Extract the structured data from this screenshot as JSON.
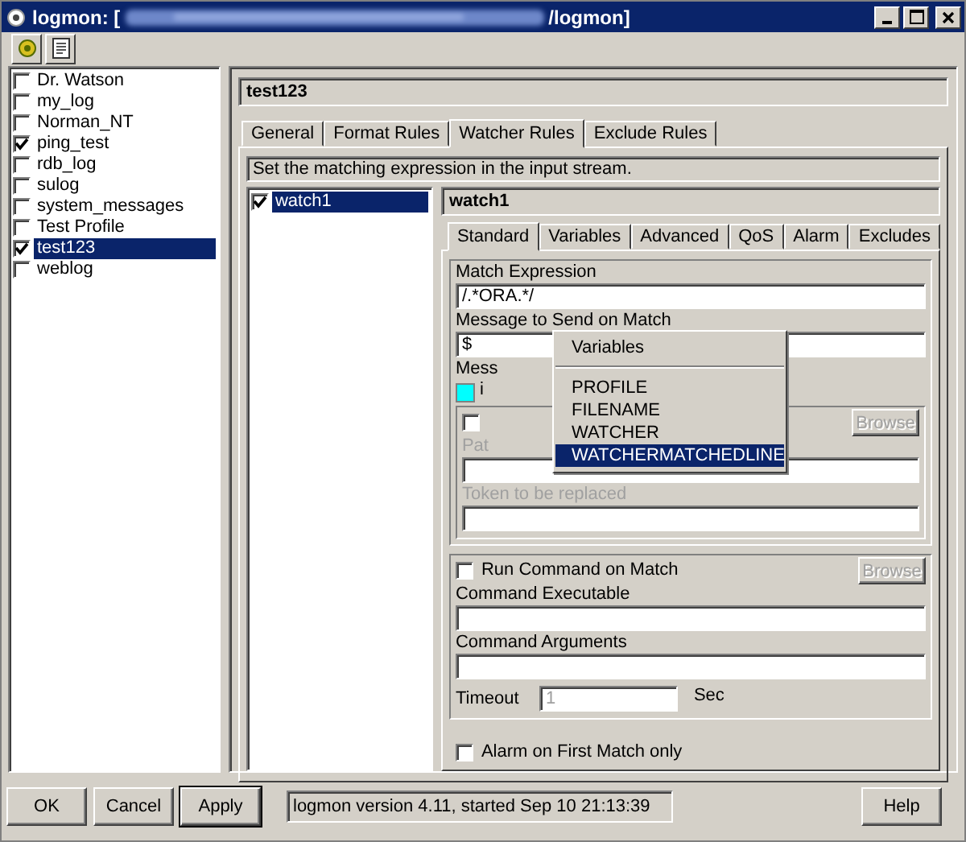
{
  "window": {
    "title_start": "logmon: [",
    "title_end": "/logmon]"
  },
  "profiles": [
    {
      "label": "Dr. Watson",
      "checked": false,
      "selected": false
    },
    {
      "label": "my_log",
      "checked": false,
      "selected": false
    },
    {
      "label": "Norman_NT",
      "checked": false,
      "selected": false
    },
    {
      "label": "ping_test",
      "checked": true,
      "selected": false
    },
    {
      "label": "rdb_log",
      "checked": false,
      "selected": false
    },
    {
      "label": "sulog",
      "checked": false,
      "selected": false
    },
    {
      "label": "system_messages",
      "checked": false,
      "selected": false
    },
    {
      "label": "Test Profile",
      "checked": false,
      "selected": false
    },
    {
      "label": "test123",
      "checked": true,
      "selected": true
    },
    {
      "label": "weblog",
      "checked": false,
      "selected": false
    }
  ],
  "profile_header": "test123",
  "tabs": [
    {
      "label": "General",
      "selected": false
    },
    {
      "label": "Format Rules",
      "selected": false
    },
    {
      "label": "Watcher Rules",
      "selected": true
    },
    {
      "label": "Exclude Rules",
      "selected": false
    }
  ],
  "hint": "Set the matching expression in the input stream.",
  "watchers": [
    {
      "label": "watch1",
      "checked": true,
      "selected": true
    }
  ],
  "watcher_header": "watch1",
  "subtabs": [
    {
      "label": "Standard",
      "selected": true
    },
    {
      "label": "Variables",
      "selected": false
    },
    {
      "label": "Advanced",
      "selected": false
    },
    {
      "label": "QoS",
      "selected": false
    },
    {
      "label": "Alarm",
      "selected": false
    },
    {
      "label": "Excludes",
      "selected": false
    }
  ],
  "standard": {
    "match_label": "Match Expression",
    "match_value": "/.*ORA.*/",
    "message_label": "Message to Send on Match",
    "message_value": "$",
    "type_label": "Mess",
    "type_text": "i",
    "path_checked": false,
    "path_label": "Pat",
    "path_browse": {
      "label": "Browse",
      "disabled": true
    },
    "token_label": "Token to be replaced"
  },
  "command": {
    "run_label": "Run Command on Match",
    "run_checked": false,
    "browse": {
      "label": "Browse",
      "disabled": true
    },
    "exe_label": "Command Executable",
    "args_label": "Command Arguments",
    "timeout_label": "Timeout",
    "timeout_value": "1",
    "timeout_unit": "Sec"
  },
  "alarm_first": {
    "label": "Alarm on First Match only",
    "checked": false
  },
  "popup": {
    "title": "Variables",
    "items": [
      {
        "label": "PROFILE",
        "selected": false
      },
      {
        "label": "FILENAME",
        "selected": false
      },
      {
        "label": "WATCHER",
        "selected": false
      },
      {
        "label": "WATCHERMATCHEDLINE",
        "selected": true
      }
    ]
  },
  "buttons": [
    {
      "label": "OK",
      "focused": false
    },
    {
      "label": "Cancel",
      "focused": false
    },
    {
      "label": "Apply",
      "focused": true
    }
  ],
  "status": "logmon version 4.11, started Sep 10 21:13:39",
  "help": "Help"
}
